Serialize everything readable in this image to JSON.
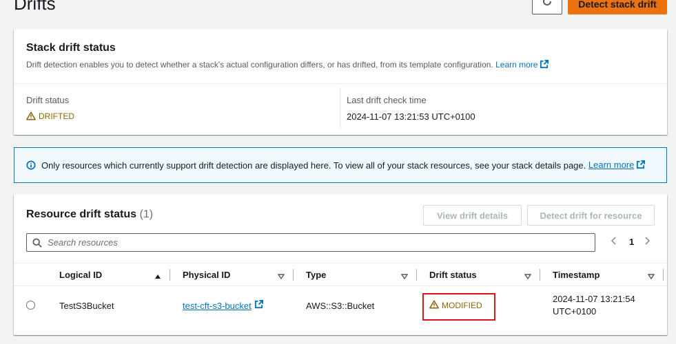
{
  "page": {
    "title": "Drifts",
    "detect_button": "Detect stack drift"
  },
  "stack_status": {
    "title": "Stack drift status",
    "description": "Drift detection enables you to detect whether a stack's actual configuration differs, or has drifted, from its template configuration.",
    "learn_more": "Learn more",
    "drift_status_label": "Drift status",
    "drift_status_value": "DRIFTED",
    "last_check_label": "Last drift check time",
    "last_check_value": "2024-11-07 13:21:53 UTC+0100"
  },
  "info_alert": {
    "text": "Only resources which currently support drift detection are displayed here. To view all of your stack resources, see your stack details page.",
    "learn_more": "Learn more"
  },
  "resources": {
    "title": "Resource drift status",
    "count": "(1)",
    "view_details_button": "View drift details",
    "detect_resource_button": "Detect drift for resource",
    "search_placeholder": "Search resources",
    "page_number": "1",
    "columns": [
      "Logical ID",
      "Physical ID",
      "Type",
      "Drift status",
      "Timestamp"
    ],
    "rows": [
      {
        "logical_id": "TestS3Bucket",
        "physical_id": "test-cft-s3-bucket",
        "type": "AWS::S3::Bucket",
        "drift_status": "MODIFIED",
        "timestamp_line1": "2024-11-07 13:21:54",
        "timestamp_line2": "UTC+0100"
      }
    ]
  },
  "colors": {
    "primary": "#ec7211",
    "link": "#0073bb",
    "warning": "#8d6605",
    "highlight_box": "#d8131b"
  }
}
